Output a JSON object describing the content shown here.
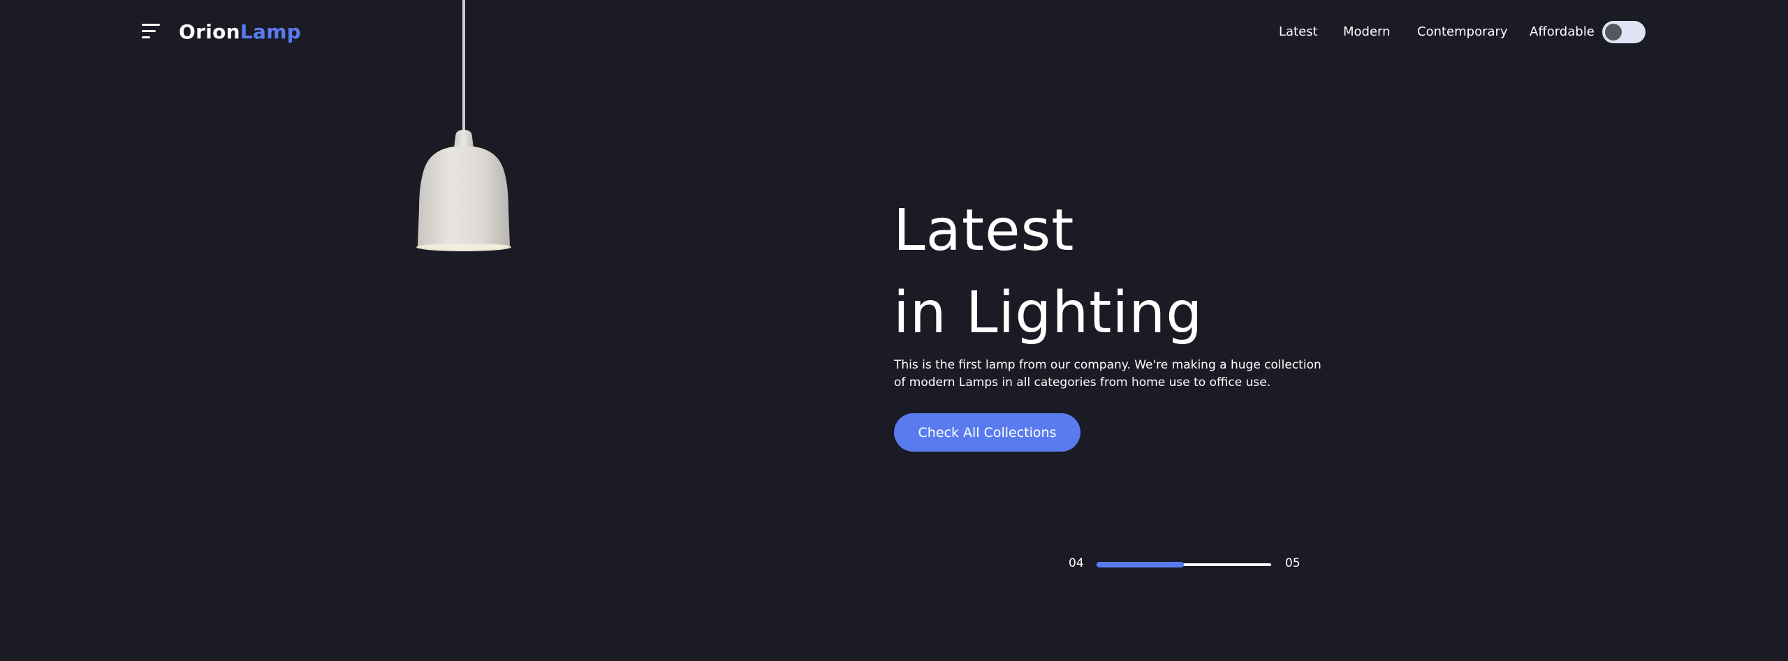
{
  "header": {
    "logo_primary": "Orion",
    "logo_accent": "Lamp",
    "nav": [
      {
        "label": "Latest"
      },
      {
        "label": "Modern"
      },
      {
        "label": "Contemporary"
      },
      {
        "label": "Affordable"
      }
    ],
    "theme_toggle": {
      "on": false
    }
  },
  "hero": {
    "title_line1": "Latest",
    "title_line2": "in Lighting",
    "description": "This is the first lamp from our company. We're making a huge collection of modern Lamps in all categories from home use to office use.",
    "cta_label": "Check All Collections"
  },
  "pager": {
    "current": "04",
    "total": "05",
    "progress": 0.5
  },
  "colors": {
    "background": "#1a1b25",
    "accent": "#5a7bf0",
    "text": "#ffffff"
  }
}
